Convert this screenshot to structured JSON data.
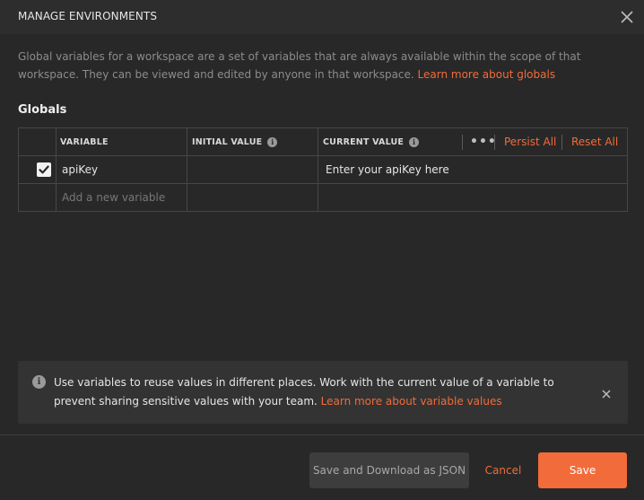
{
  "modal": {
    "title": "MANAGE ENVIRONMENTS",
    "close_icon": "close-icon"
  },
  "description": {
    "text": "Global variables for a workspace are a set of variables that are always available within the scope of that workspace. They can be viewed and edited by anyone in that workspace. ",
    "link": "Learn more about globals"
  },
  "section_title": "Globals",
  "table": {
    "headers": {
      "variable": "VARIABLE",
      "initial_value": "INITIAL VALUE",
      "current_value": "CURRENT VALUE",
      "more": "•••",
      "persist_all": "Persist All",
      "reset_all": "Reset All"
    },
    "rows": [
      {
        "checked": true,
        "variable": "apiKey",
        "initial_value": "",
        "current_value": "Enter your apiKey here"
      }
    ],
    "new_row": {
      "placeholder": "Add a new variable"
    }
  },
  "banner": {
    "icon": "info-icon",
    "text": "Use variables to reuse values in different places. Work with the current value of a variable to prevent sharing sensitive values with your team. ",
    "link": "Learn more about variable values"
  },
  "footer": {
    "save_download": "Save and Download as JSON",
    "cancel": "Cancel",
    "save": "Save"
  },
  "colors": {
    "accent": "#f26b3a",
    "background": "#282828",
    "header": "#2d2d2d"
  }
}
